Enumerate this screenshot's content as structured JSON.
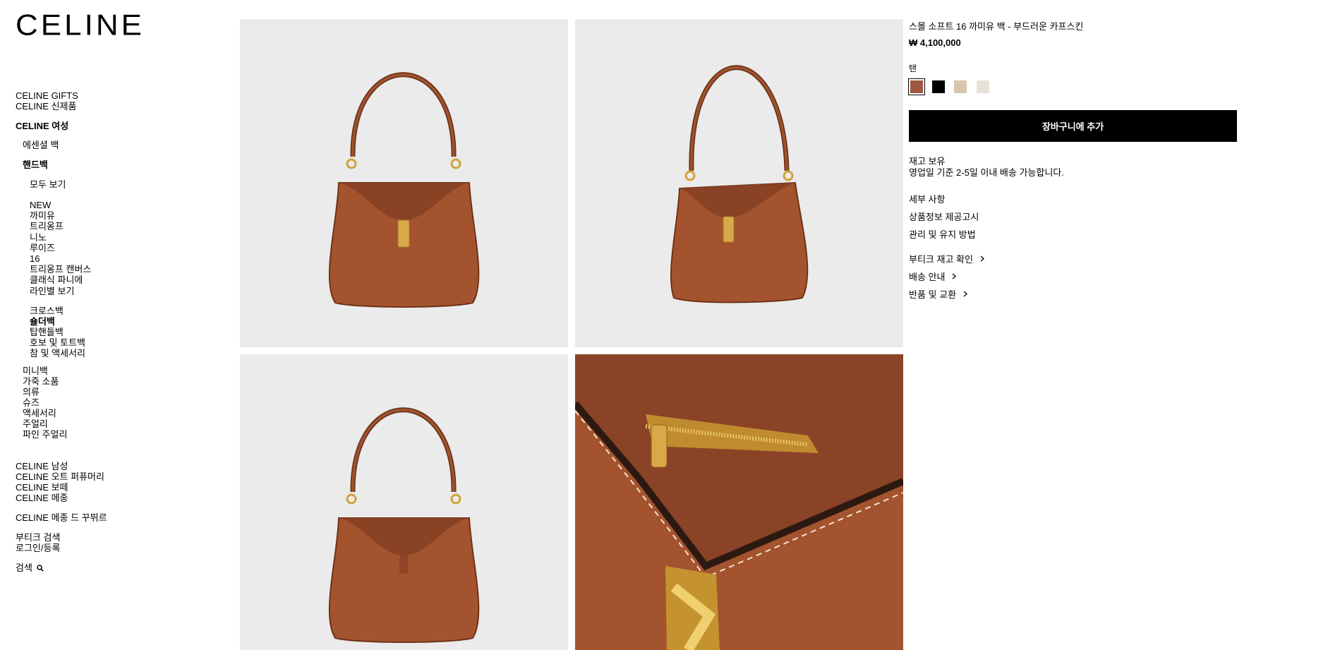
{
  "brand": {
    "logo": "CELINE"
  },
  "nav": {
    "gifts": "CELINE GIFTS",
    "new_arrivals": "CELINE 신제품",
    "women": "CELINE 여성",
    "essential_bags": "에센셜 백",
    "handbags": "핸드백",
    "view_all": "모두 보기",
    "lines": [
      "NEW",
      "까미유",
      "트리옹프",
      "니노",
      "루이즈",
      "16",
      "트리옹프 캔버스",
      "클래식 파니에",
      "라인별 보기"
    ],
    "bag_types": [
      "크로스백",
      "숄더백",
      "탑핸들백",
      "호보 및 토트백",
      "참 및 액세서리"
    ],
    "active_bag_type": "숄더백",
    "women_categories": [
      "미니백",
      "가죽 소품",
      "의류",
      "슈즈",
      "액세서리",
      "주얼리",
      "파인 주얼리"
    ],
    "other_sections": [
      "CELINE 남성",
      "CELINE 오트 퍼퓨머리",
      "CELINE 보떼",
      "CELINE 메종"
    ],
    "maison_couture": "CELINE 메종 드 꾸뛰르",
    "store_search": "부티크 검색",
    "login": "로그인/등록",
    "search": "검색",
    "search_icon": "search-icon"
  },
  "product": {
    "name": "스몰 소프트 16 까미유 백 - 부드러운 카프스킨",
    "price": "₩ 4,100,000",
    "color_name": "탠",
    "swatches": [
      {
        "name": "tan",
        "color": "#a0573f",
        "selected": true
      },
      {
        "name": "black",
        "color": "#000000",
        "selected": false
      },
      {
        "name": "beige",
        "color": "#d8c6ad",
        "selected": false
      },
      {
        "name": "ivory",
        "color": "#e6e2d6",
        "selected": false
      }
    ],
    "add_to_cart": "장바구니에 추가",
    "stock_status": "재고 보유",
    "delivery_note": "영업일 기준 2-5일 이내 배송 가능합니다.",
    "details": "세부 사항",
    "product_info": "상품정보 제공고시",
    "care": "관리 및 유지 방법",
    "boutique_stock": "부티크 재고 확인",
    "shipping": "배송 안내",
    "returns": "반품 및 교환",
    "chevron_icon": "chevron-right-icon"
  },
  "colors": {
    "leather": "#a4532f",
    "leather_dark": "#7a3a1f",
    "gold": "#d4a23c",
    "photo_bg": "#ebebeb"
  }
}
